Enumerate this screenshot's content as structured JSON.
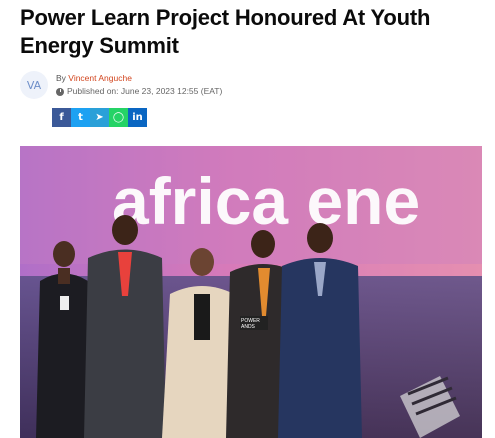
{
  "article": {
    "headline": "Power Learn Project Honoured At Youth Energy Summit",
    "byline": {
      "avatar_initials": "VA",
      "by_label": "By",
      "author": "Vincent Anguche",
      "published": "Published on: June 23, 2023 12:55 (EAT)"
    },
    "share": [
      {
        "name": "facebook",
        "glyph": "f",
        "color": "#3b5998"
      },
      {
        "name": "twitter",
        "glyph": "t",
        "color": "#1da1f2"
      },
      {
        "name": "telegram",
        "glyph": "➤",
        "color": "#2aa0d8"
      },
      {
        "name": "whatsapp",
        "glyph": "◯",
        "color": "#25d366"
      },
      {
        "name": "linkedin",
        "glyph": "in",
        "color": "#0a66c2"
      }
    ],
    "photo": {
      "backdrop_text": "africa ene",
      "podium_text": "POWER\nANDS"
    }
  }
}
